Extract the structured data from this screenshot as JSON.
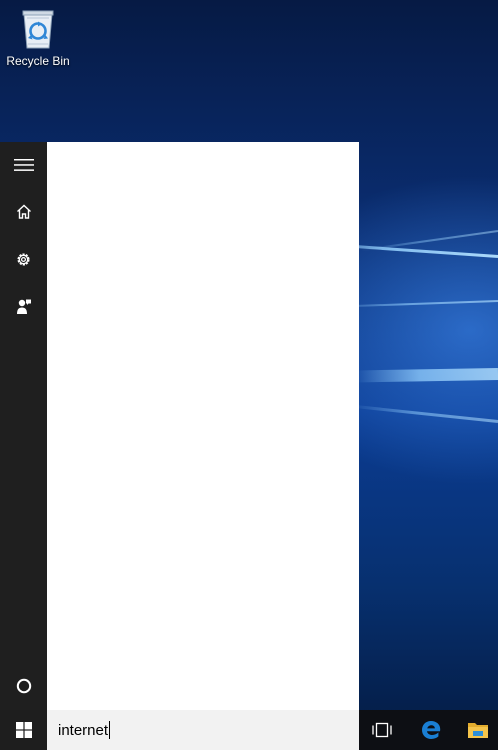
{
  "desktop": {
    "icons": [
      {
        "label": "Recycle Bin",
        "icon": "recycle-bin-icon"
      }
    ]
  },
  "start_rail": {
    "items": [
      {
        "icon": "hamburger-menu-icon"
      },
      {
        "icon": "home-icon"
      },
      {
        "icon": "settings-gear-icon"
      },
      {
        "icon": "feedback-person-icon"
      },
      {
        "icon": "cortana-circle-icon"
      }
    ]
  },
  "search": {
    "query": "internet"
  },
  "taskbar": {
    "items": [
      {
        "icon": "windows-start-icon"
      },
      {
        "icon": "task-view-icon"
      },
      {
        "icon": "edge-browser-icon"
      },
      {
        "icon": "file-explorer-icon"
      }
    ],
    "colors": {
      "edge": "#1a7fd4",
      "explorer_folder": "#f4c44b"
    }
  }
}
